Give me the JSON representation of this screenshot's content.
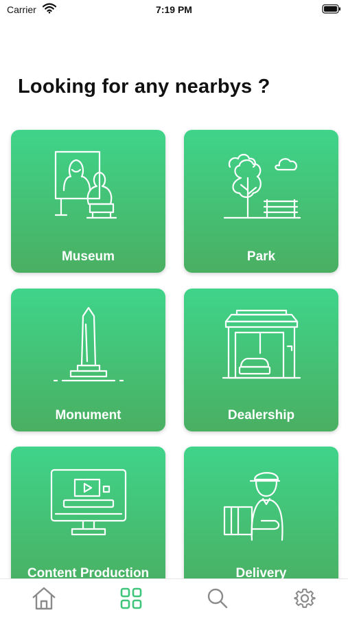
{
  "status_bar": {
    "carrier": "Carrier",
    "time": "7:19 PM"
  },
  "page": {
    "title": "Looking for any nearbys ?"
  },
  "categories": [
    {
      "label": "Museum",
      "icon": "museum-icon"
    },
    {
      "label": "Park",
      "icon": "park-icon"
    },
    {
      "label": "Monument",
      "icon": "monument-icon"
    },
    {
      "label": "Dealership",
      "icon": "dealership-icon"
    },
    {
      "label": "Content Production",
      "icon": "content-production-icon"
    },
    {
      "label": "Delivery",
      "icon": "delivery-icon"
    }
  ],
  "tab_bar": {
    "items": [
      {
        "icon": "home-icon",
        "active": false
      },
      {
        "icon": "grid-icon",
        "active": true
      },
      {
        "icon": "search-icon",
        "active": false
      },
      {
        "icon": "gear-icon",
        "active": false
      }
    ]
  },
  "colors": {
    "card_gradient_top": "#3fd48a",
    "card_gradient_bottom": "#4aaf62",
    "tab_active": "#3fc57a",
    "tab_inactive": "#8a8a8a",
    "title_text": "#111111"
  }
}
